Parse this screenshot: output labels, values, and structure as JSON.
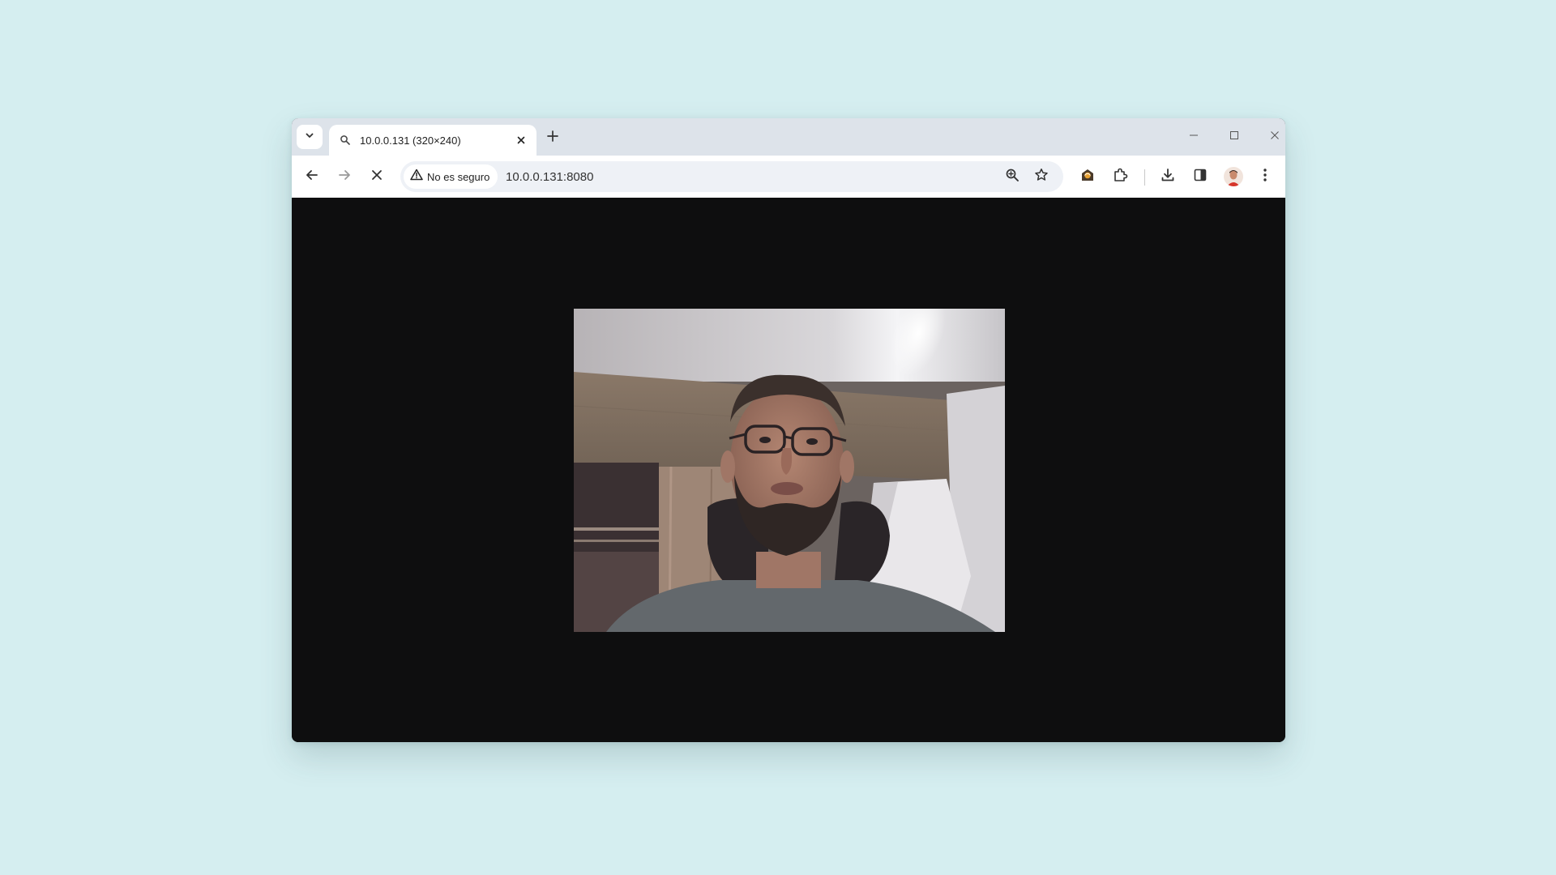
{
  "browser": {
    "tab": {
      "title": "10.0.0.131 (320×240)"
    },
    "toolbar": {
      "security_label": "No es seguro",
      "url": "10.0.0.131:8080"
    }
  },
  "icons": {
    "tab_search": "chevron-down-icon",
    "favicon": "search-favicon-icon",
    "tab_close": "close-icon",
    "new_tab": "plus-icon",
    "minimize": "minimize-icon",
    "maximize": "maximize-icon",
    "close_window": "close-icon",
    "back": "arrow-left-icon",
    "forward": "arrow-right-icon",
    "stop": "close-icon",
    "warning": "warning-triangle-icon",
    "zoom": "zoom-in-icon",
    "bookmark": "star-icon",
    "extension_1": "extension-badge-icon",
    "extensions": "puzzle-icon",
    "downloads": "download-icon",
    "side_panel": "side-panel-icon",
    "profile": "avatar",
    "menu": "more-vertical-icon"
  },
  "colors": {
    "desktop_bg": "#d5eef0",
    "tabstrip_bg": "#dde3ea",
    "toolbar_bg": "#ffffff",
    "omnibox_bg": "#eef1f6",
    "viewport_bg": "#0e0e0f"
  }
}
